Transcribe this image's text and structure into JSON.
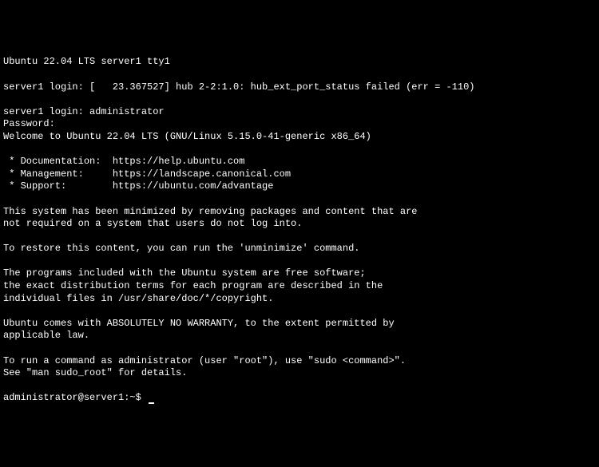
{
  "header": "Ubuntu 22.04 LTS server1 tty1",
  "login_error": "server1 login: [   23.367527] hub 2-2:1.0: hub_ext_port_status failed (err = -110)",
  "login_user": "server1 login: administrator",
  "password_prompt": "Password:",
  "welcome": "Welcome to Ubuntu 22.04 LTS (GNU/Linux 5.15.0-41-generic x86_64)",
  "links": {
    "doc": " * Documentation:  https://help.ubuntu.com",
    "mgmt": " * Management:     https://landscape.canonical.com",
    "support": " * Support:        https://ubuntu.com/advantage"
  },
  "minimized1": "This system has been minimized by removing packages and content that are",
  "minimized2": "not required on a system that users do not log into.",
  "restore": "To restore this content, you can run the 'unminimize' command.",
  "programs1": "The programs included with the Ubuntu system are free software;",
  "programs2": "the exact distribution terms for each program are described in the",
  "programs3": "individual files in /usr/share/doc/*/copyright.",
  "warranty1": "Ubuntu comes with ABSOLUTELY NO WARRANTY, to the extent permitted by",
  "warranty2": "applicable law.",
  "sudo1": "To run a command as administrator (user \"root\"), use \"sudo <command>\".",
  "sudo2": "See \"man sudo_root\" for details.",
  "prompt": "administrator@server1:~$ "
}
